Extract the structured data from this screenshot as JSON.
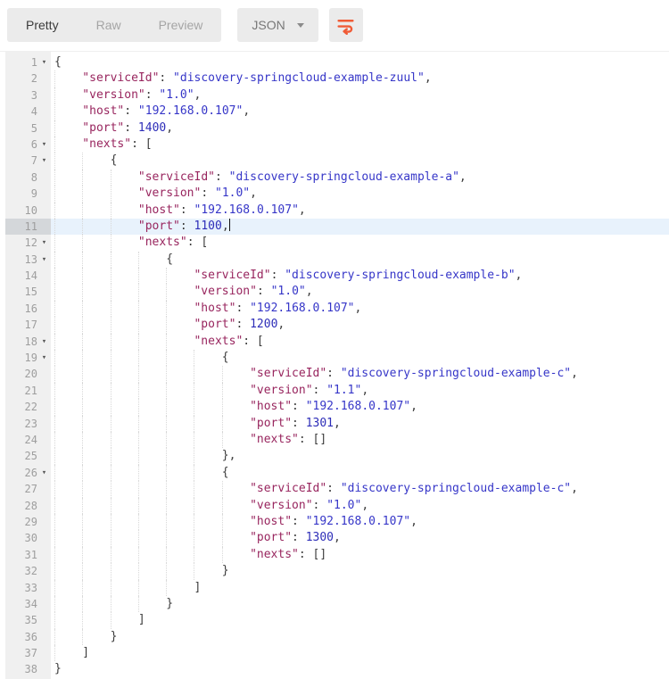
{
  "colors": {
    "accent": "#F05B36",
    "btn_bg": "#EBEBEB",
    "tab_active": "#3B3B3B",
    "tab_inactive": "#A5A5A5",
    "dd_text": "#777777",
    "gutter_bg": "#F0F0F0",
    "active_bg": "#E8F2FC",
    "active_gutter": "#D4D7DA",
    "ln_color": "#9E9E9E",
    "guide": "#D8D8D8",
    "key": "#98255E",
    "str": "#3636C8",
    "num": "#2D2DB8",
    "pun": "#3C3C3C"
  },
  "toolbar": {
    "tabs": [
      {
        "label": "Pretty",
        "active": true
      },
      {
        "label": "Raw",
        "active": false
      },
      {
        "label": "Preview",
        "active": false
      }
    ],
    "language": "JSON",
    "wrap_icon": "wrap-text-icon"
  },
  "editor": {
    "active_line": 11,
    "cursor_line": 11,
    "fold_glyph": "▾",
    "lines": [
      {
        "n": 1,
        "fold": true,
        "indent": 0,
        "tokens": [
          [
            "p",
            "{"
          ]
        ]
      },
      {
        "n": 2,
        "indent": 1,
        "tokens": [
          [
            "k",
            "\"serviceId\""
          ],
          [
            "p",
            ": "
          ],
          [
            "s",
            "\"discovery-springcloud-example-zuul\""
          ],
          [
            "p",
            ","
          ]
        ]
      },
      {
        "n": 3,
        "indent": 1,
        "tokens": [
          [
            "k",
            "\"version\""
          ],
          [
            "p",
            ": "
          ],
          [
            "s",
            "\"1.0\""
          ],
          [
            "p",
            ","
          ]
        ]
      },
      {
        "n": 4,
        "indent": 1,
        "tokens": [
          [
            "k",
            "\"host\""
          ],
          [
            "p",
            ": "
          ],
          [
            "s",
            "\"192.168.0.107\""
          ],
          [
            "p",
            ","
          ]
        ]
      },
      {
        "n": 5,
        "indent": 1,
        "tokens": [
          [
            "k",
            "\"port\""
          ],
          [
            "p",
            ": "
          ],
          [
            "n",
            "1400"
          ],
          [
            "p",
            ","
          ]
        ]
      },
      {
        "n": 6,
        "fold": true,
        "indent": 1,
        "tokens": [
          [
            "k",
            "\"nexts\""
          ],
          [
            "p",
            ": ["
          ]
        ]
      },
      {
        "n": 7,
        "fold": true,
        "indent": 2,
        "tokens": [
          [
            "p",
            "{"
          ]
        ]
      },
      {
        "n": 8,
        "indent": 3,
        "tokens": [
          [
            "k",
            "\"serviceId\""
          ],
          [
            "p",
            ": "
          ],
          [
            "s",
            "\"discovery-springcloud-example-a\""
          ],
          [
            "p",
            ","
          ]
        ]
      },
      {
        "n": 9,
        "indent": 3,
        "tokens": [
          [
            "k",
            "\"version\""
          ],
          [
            "p",
            ": "
          ],
          [
            "s",
            "\"1.0\""
          ],
          [
            "p",
            ","
          ]
        ]
      },
      {
        "n": 10,
        "indent": 3,
        "tokens": [
          [
            "k",
            "\"host\""
          ],
          [
            "p",
            ": "
          ],
          [
            "s",
            "\"192.168.0.107\""
          ],
          [
            "p",
            ","
          ]
        ]
      },
      {
        "n": 11,
        "indent": 3,
        "tokens": [
          [
            "k",
            "\"port\""
          ],
          [
            "p",
            ": "
          ],
          [
            "n",
            "1100"
          ],
          [
            "p",
            ","
          ]
        ]
      },
      {
        "n": 12,
        "fold": true,
        "indent": 3,
        "tokens": [
          [
            "k",
            "\"nexts\""
          ],
          [
            "p",
            ": ["
          ]
        ]
      },
      {
        "n": 13,
        "fold": true,
        "indent": 4,
        "tokens": [
          [
            "p",
            "{"
          ]
        ]
      },
      {
        "n": 14,
        "indent": 5,
        "tokens": [
          [
            "k",
            "\"serviceId\""
          ],
          [
            "p",
            ": "
          ],
          [
            "s",
            "\"discovery-springcloud-example-b\""
          ],
          [
            "p",
            ","
          ]
        ]
      },
      {
        "n": 15,
        "indent": 5,
        "tokens": [
          [
            "k",
            "\"version\""
          ],
          [
            "p",
            ": "
          ],
          [
            "s",
            "\"1.0\""
          ],
          [
            "p",
            ","
          ]
        ]
      },
      {
        "n": 16,
        "indent": 5,
        "tokens": [
          [
            "k",
            "\"host\""
          ],
          [
            "p",
            ": "
          ],
          [
            "s",
            "\"192.168.0.107\""
          ],
          [
            "p",
            ","
          ]
        ]
      },
      {
        "n": 17,
        "indent": 5,
        "tokens": [
          [
            "k",
            "\"port\""
          ],
          [
            "p",
            ": "
          ],
          [
            "n",
            "1200"
          ],
          [
            "p",
            ","
          ]
        ]
      },
      {
        "n": 18,
        "fold": true,
        "indent": 5,
        "tokens": [
          [
            "k",
            "\"nexts\""
          ],
          [
            "p",
            ": ["
          ]
        ]
      },
      {
        "n": 19,
        "fold": true,
        "indent": 6,
        "tokens": [
          [
            "p",
            "{"
          ]
        ]
      },
      {
        "n": 20,
        "indent": 7,
        "tokens": [
          [
            "k",
            "\"serviceId\""
          ],
          [
            "p",
            ": "
          ],
          [
            "s",
            "\"discovery-springcloud-example-c\""
          ],
          [
            "p",
            ","
          ]
        ]
      },
      {
        "n": 21,
        "indent": 7,
        "tokens": [
          [
            "k",
            "\"version\""
          ],
          [
            "p",
            ": "
          ],
          [
            "s",
            "\"1.1\""
          ],
          [
            "p",
            ","
          ]
        ]
      },
      {
        "n": 22,
        "indent": 7,
        "tokens": [
          [
            "k",
            "\"host\""
          ],
          [
            "p",
            ": "
          ],
          [
            "s",
            "\"192.168.0.107\""
          ],
          [
            "p",
            ","
          ]
        ]
      },
      {
        "n": 23,
        "indent": 7,
        "tokens": [
          [
            "k",
            "\"port\""
          ],
          [
            "p",
            ": "
          ],
          [
            "n",
            "1301"
          ],
          [
            "p",
            ","
          ]
        ]
      },
      {
        "n": 24,
        "indent": 7,
        "tokens": [
          [
            "k",
            "\"nexts\""
          ],
          [
            "p",
            ": []"
          ]
        ]
      },
      {
        "n": 25,
        "indent": 6,
        "tokens": [
          [
            "p",
            "},"
          ]
        ]
      },
      {
        "n": 26,
        "fold": true,
        "indent": 6,
        "tokens": [
          [
            "p",
            "{"
          ]
        ]
      },
      {
        "n": 27,
        "indent": 7,
        "tokens": [
          [
            "k",
            "\"serviceId\""
          ],
          [
            "p",
            ": "
          ],
          [
            "s",
            "\"discovery-springcloud-example-c\""
          ],
          [
            "p",
            ","
          ]
        ]
      },
      {
        "n": 28,
        "indent": 7,
        "tokens": [
          [
            "k",
            "\"version\""
          ],
          [
            "p",
            ": "
          ],
          [
            "s",
            "\"1.0\""
          ],
          [
            "p",
            ","
          ]
        ]
      },
      {
        "n": 29,
        "indent": 7,
        "tokens": [
          [
            "k",
            "\"host\""
          ],
          [
            "p",
            ": "
          ],
          [
            "s",
            "\"192.168.0.107\""
          ],
          [
            "p",
            ","
          ]
        ]
      },
      {
        "n": 30,
        "indent": 7,
        "tokens": [
          [
            "k",
            "\"port\""
          ],
          [
            "p",
            ": "
          ],
          [
            "n",
            "1300"
          ],
          [
            "p",
            ","
          ]
        ]
      },
      {
        "n": 31,
        "indent": 7,
        "tokens": [
          [
            "k",
            "\"nexts\""
          ],
          [
            "p",
            ": []"
          ]
        ]
      },
      {
        "n": 32,
        "indent": 6,
        "tokens": [
          [
            "p",
            "}"
          ]
        ]
      },
      {
        "n": 33,
        "indent": 5,
        "tokens": [
          [
            "p",
            "]"
          ]
        ]
      },
      {
        "n": 34,
        "indent": 4,
        "tokens": [
          [
            "p",
            "}"
          ]
        ]
      },
      {
        "n": 35,
        "indent": 3,
        "tokens": [
          [
            "p",
            "]"
          ]
        ]
      },
      {
        "n": 36,
        "indent": 2,
        "tokens": [
          [
            "p",
            "}"
          ]
        ]
      },
      {
        "n": 37,
        "indent": 1,
        "tokens": [
          [
            "p",
            "]"
          ]
        ]
      },
      {
        "n": 38,
        "indent": 0,
        "tokens": [
          [
            "p",
            "}"
          ]
        ]
      }
    ]
  }
}
